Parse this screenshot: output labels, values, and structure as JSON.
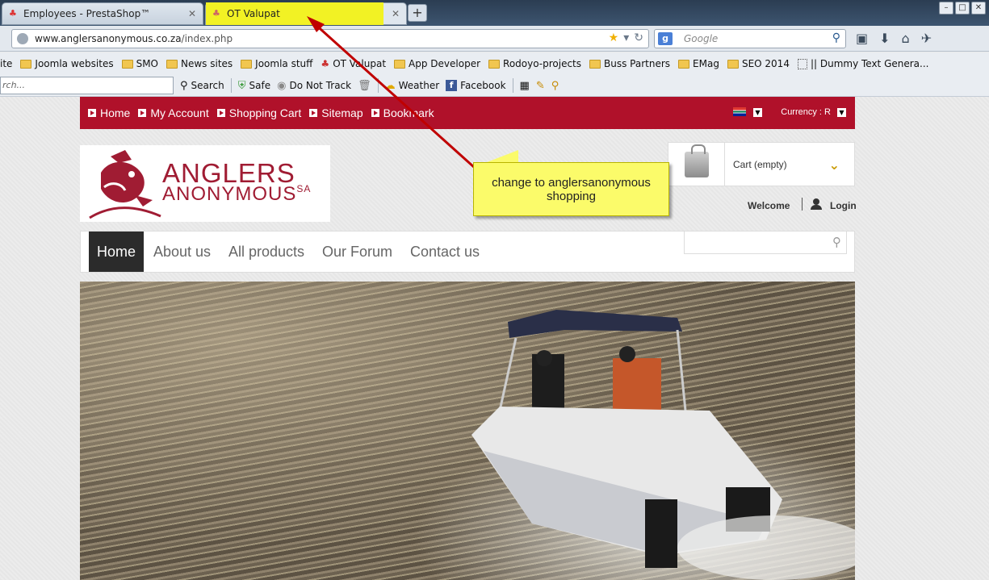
{
  "browser": {
    "tabs": [
      {
        "title": "Employees - PrestaShop™"
      },
      {
        "title": "OT Valupat"
      }
    ],
    "url": {
      "domain": "www.anglersanonymous.co.za",
      "path": "/index.php"
    },
    "search_placeholder": "Google",
    "bookmarks": [
      {
        "label": "ite",
        "type": "partial"
      },
      {
        "label": "Joomla websites",
        "type": "folder"
      },
      {
        "label": "SMO",
        "type": "folder"
      },
      {
        "label": "News sites",
        "type": "folder"
      },
      {
        "label": "Joomla stuff",
        "type": "folder"
      },
      {
        "label": "OT Valupat",
        "type": "page"
      },
      {
        "label": "App Developer",
        "type": "folder"
      },
      {
        "label": "Rodoyo-projects",
        "type": "folder"
      },
      {
        "label": "Buss Partners",
        "type": "folder"
      },
      {
        "label": "EMag",
        "type": "folder"
      },
      {
        "label": "SEO 2014",
        "type": "folder"
      },
      {
        "label": "|| Dummy Text Genera...",
        "type": "page"
      }
    ],
    "addons": {
      "search_placeholder": "rch...",
      "search_label": "Search",
      "safe_label": "Safe",
      "dnt_label": "Do Not Track",
      "weather_label": "Weather",
      "facebook_label": "Facebook"
    }
  },
  "site": {
    "topbar": {
      "links": [
        "Home",
        "My Account",
        "Shopping Cart",
        "Sitemap",
        "Bookmark"
      ],
      "currency": "Currency : R"
    },
    "logo": {
      "line1": "ANGLERS",
      "line2": "ANONYMOUS",
      "suffix": "SA"
    },
    "cart": {
      "label": "Cart (empty)"
    },
    "account": {
      "welcome": "Welcome",
      "login": "Login"
    },
    "nav": [
      "Home",
      "About us",
      "All products",
      "Our Forum",
      "Contact us"
    ]
  },
  "annotation": {
    "text": "change to anglersanonymous shopping",
    "color": "#fbfb6a",
    "arrow_color": "#c00000"
  },
  "colors": {
    "brand_red": "#b0112a",
    "tab_highlight": "#f2f224",
    "cart_chevron": "#c99a00"
  }
}
